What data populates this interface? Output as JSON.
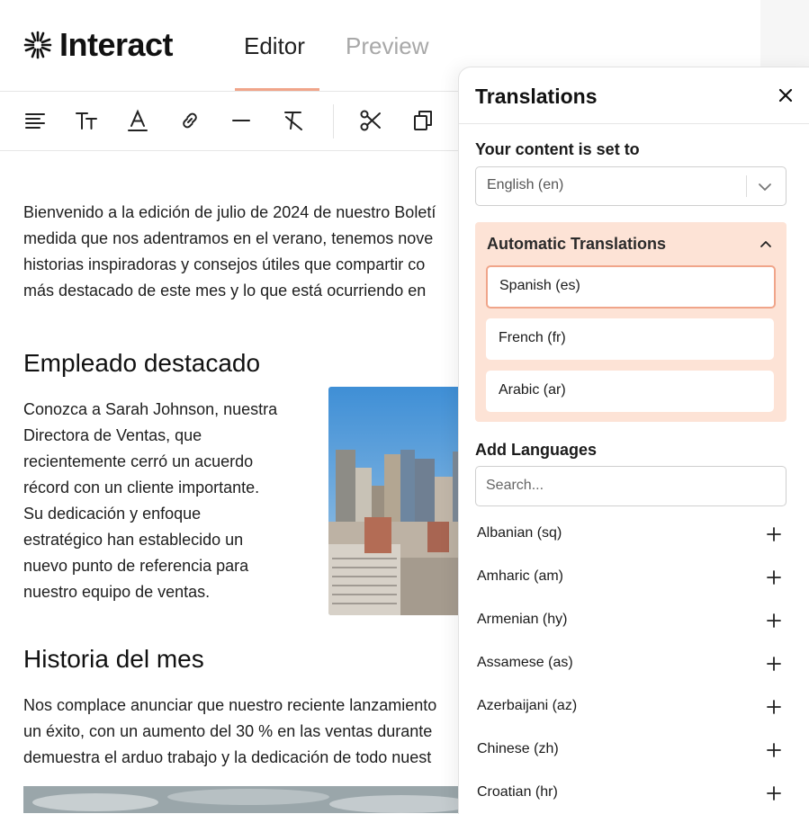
{
  "app": {
    "logo_text": "Interact",
    "tabs": [
      {
        "label": "Editor",
        "active": true
      },
      {
        "label": "Preview",
        "active": false
      }
    ],
    "accent_color": "#f0a58a"
  },
  "toolbar": {
    "icons": [
      "align-left-icon",
      "text-size-icon",
      "text-color-icon",
      "link-icon",
      "divider-icon",
      "clear-format-icon",
      "cut-icon",
      "copy-icon"
    ]
  },
  "article": {
    "intro_lines": [
      "Bienvenido a la edición de julio de 2024 de nuestro Boletí",
      "medida que nos adentramos en el verano, tenemos nove",
      "historias inspiradoras y consejos útiles que compartir co",
      "más destacado de este mes y lo que está ocurriendo en"
    ],
    "heading1": "Empleado destacado",
    "feature_lines": [
      "Conozca a Sarah Johnson, nuestra",
      "Directora de Ventas, que",
      "recientemente cerró un acuerdo",
      "récord con un cliente importante.",
      "Su dedicación y enfoque",
      "estratégico han establecido un",
      "nuevo punto de referencia para",
      "nuestro equipo de ventas."
    ],
    "heading2": "Historia del mes",
    "story_lines": [
      "Nos complace anunciar que nuestro reciente lanzamiento",
      "un éxito, con un aumento del 30 % en las ventas durante",
      "demuestra el arduo trabajo y la dedicación de todo nuest"
    ]
  },
  "panel": {
    "title": "Translations",
    "content_label": "Your content is set to",
    "content_language": "English (en)",
    "auto_title": "Automatic Translations",
    "auto_languages": [
      "Spanish (es)",
      "French (fr)",
      "Arabic (ar)"
    ],
    "add_label": "Add Languages",
    "search_placeholder": "Search...",
    "languages": [
      "Albanian (sq)",
      "Amharic (am)",
      "Armenian (hy)",
      "Assamese (as)",
      "Azerbaijani (az)",
      "Chinese (zh)",
      "Croatian (hr)"
    ],
    "colors": {
      "auto_bg": "#fde3d6",
      "border": "#cfcfcf"
    }
  }
}
